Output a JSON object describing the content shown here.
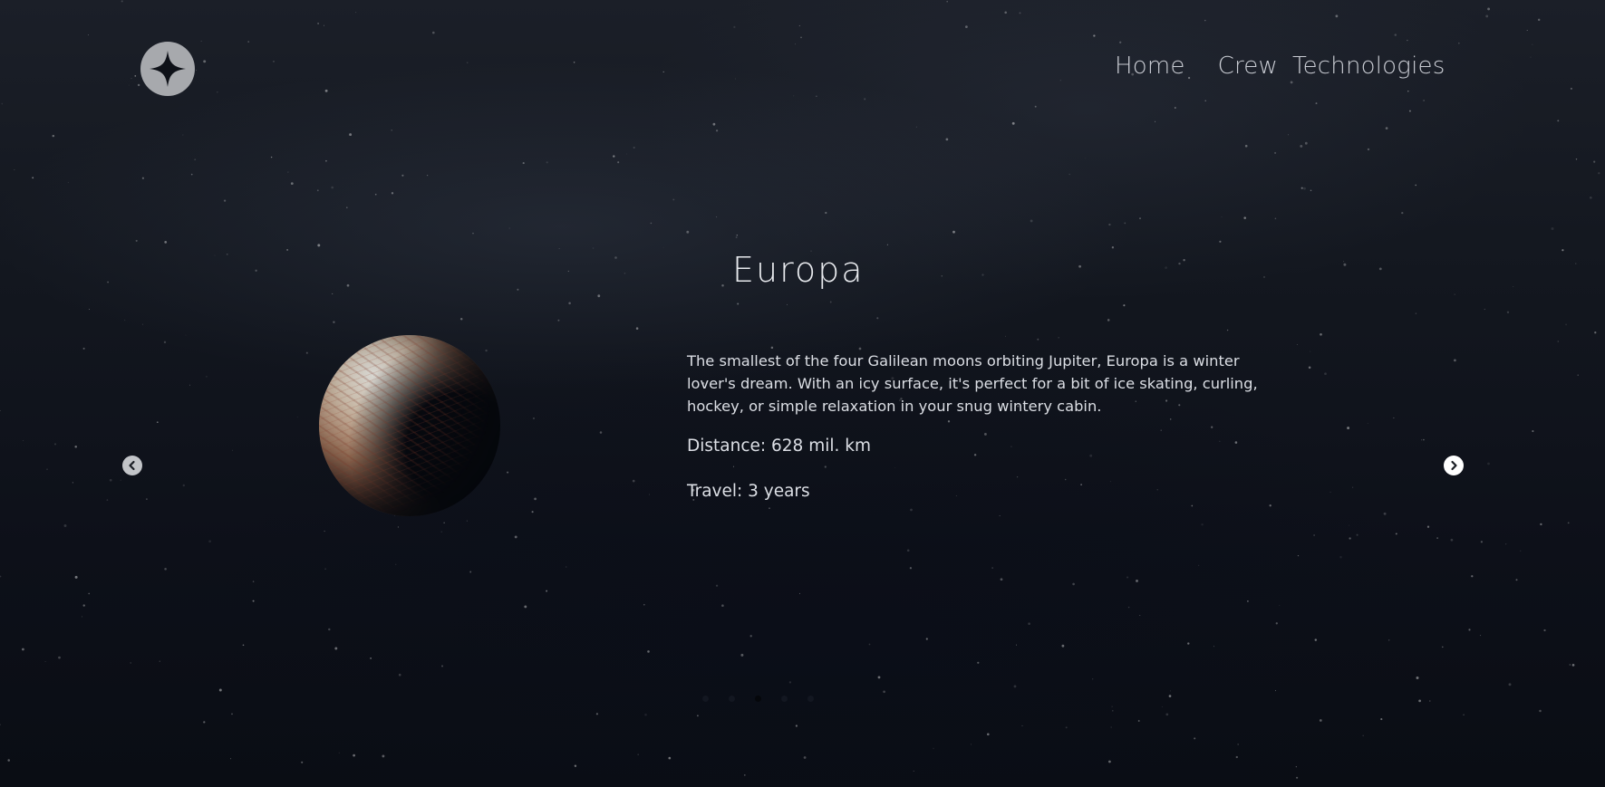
{
  "nav": {
    "items": [
      {
        "label": "Home"
      },
      {
        "label": "Crew"
      },
      {
        "label": "Technologies"
      }
    ]
  },
  "destination": {
    "name": "Europa",
    "description": "The smallest of the four Galilean moons orbiting Jupiter, Europa is a winter lover's dream. With an icy surface, it's perfect for a bit of ice skating, curling, hockey, or simple relaxation in your snug wintery cabin.",
    "distance": "Distance: 628 mil. km",
    "travel": "Travel: 3 years"
  },
  "carousel": {
    "slide_count": 5,
    "active_index": 2
  },
  "icons": {
    "logo": "four-point-star-icon",
    "prev": "chevron-left-icon",
    "next": "chevron-right-icon"
  },
  "colors": {
    "background": "#0b0e15",
    "text": "#dcdfe5",
    "logo_bg": "#a7a9ad"
  }
}
